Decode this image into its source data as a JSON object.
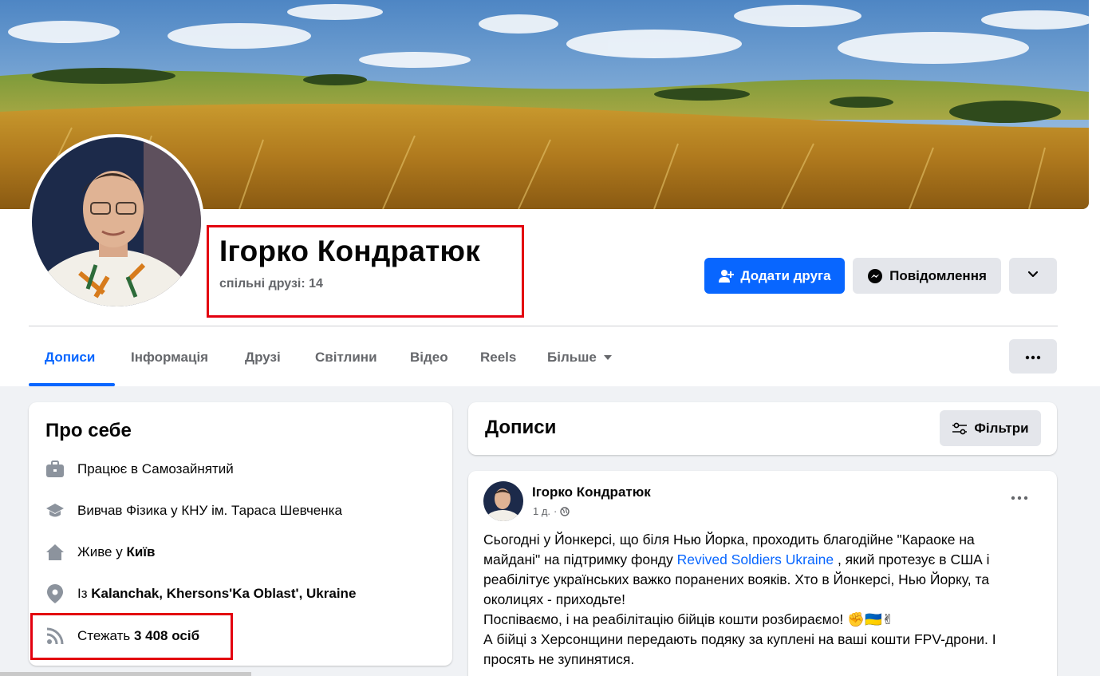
{
  "profile": {
    "name": "Ігорко Кондратюк",
    "mutual_friends": "спільні друзі: 14"
  },
  "actions": {
    "add_friend": "Додати друга",
    "message": "Повідомлення"
  },
  "tabs": [
    {
      "label": "Дописи"
    },
    {
      "label": "Інформація"
    },
    {
      "label": "Друзі"
    },
    {
      "label": "Світлини"
    },
    {
      "label": "Відео"
    },
    {
      "label": "Reels"
    },
    {
      "label": "Більше"
    }
  ],
  "about": {
    "title": "Про себе",
    "work_prefix": "Працює в ",
    "work_value": "Самозайнятий",
    "study_prefix": "Вивчав Фізика у ",
    "study_value": "КНУ ім. Тараса Шевченка",
    "lives_prefix": "Живе у ",
    "lives_value": "Київ",
    "from_prefix": "Із ",
    "from_value": "Kalanchak, Khersons'Ka Oblast', Ukraine",
    "followers_prefix": "Стежать ",
    "followers_value": "3 408 осіб"
  },
  "posts": {
    "title": "Дописи",
    "filter_label": "Фільтри"
  },
  "post": {
    "author": "Ігорко Кондратюк",
    "time": "1 д.",
    "text_part1": "Сьогодні у Йонкерсі, що біля Нью Йорка, проходить благодійне \"Караоке на майдані\" на підтримку фонду ",
    "link": "Revived Soldiers Ukraine",
    "text_part2": " , який протезує в США і реабілітує українських важко поранених вояків. Хто в Йонкерсі, Нью Йорку, та околицях - приходьте!",
    "line2": "Поспіваємо, і на реабілітацію бійців кошти розбираємо! ✊🇺🇦✌",
    "line3": "А бійці з Херсонщини передають подяку за куплені на ваші кошти FPV-дрони. І просять не зупинятися."
  },
  "colors": {
    "accent": "#0866ff",
    "highlight_box": "#e3000f",
    "secondary_text": "#65676b",
    "button_gray": "#e4e6eb",
    "page_bg": "#f0f2f5"
  }
}
